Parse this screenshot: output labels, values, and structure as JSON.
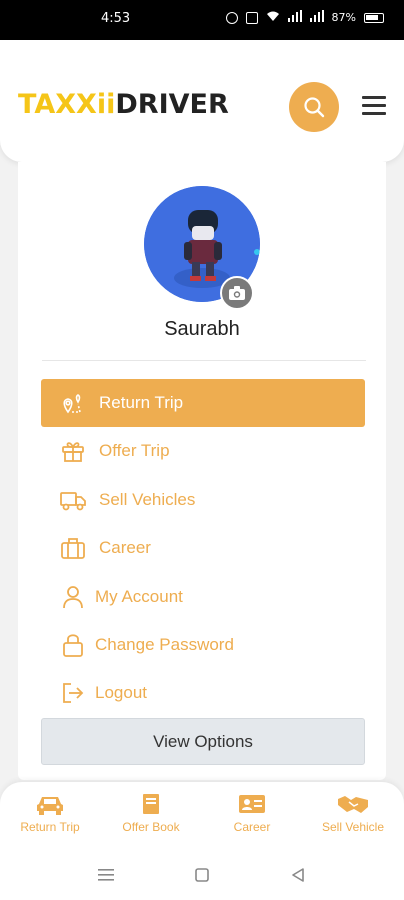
{
  "status_bar": {
    "time": "4:53",
    "battery": "87%"
  },
  "header": {
    "brand_part1": "TAXXii",
    "brand_part2": "DRIVER"
  },
  "profile": {
    "name": "Saurabh"
  },
  "menu": [
    {
      "label": "Return Trip",
      "icon": "map-pin-route-icon",
      "active": true
    },
    {
      "label": "Offer Trip",
      "icon": "gift-icon",
      "active": false
    },
    {
      "label": "Sell Vehicles",
      "icon": "truck-icon",
      "active": false
    },
    {
      "label": "Career",
      "icon": "briefcase-icon",
      "active": false
    },
    {
      "label": "My Account",
      "icon": "user-icon",
      "active": false
    },
    {
      "label": "Change Password",
      "icon": "lock-icon",
      "active": false
    },
    {
      "label": "Logout",
      "icon": "logout-icon",
      "active": false
    }
  ],
  "view_options_label": "View Options",
  "bottom_nav": [
    {
      "label": "Return Trip",
      "icon": "car-icon"
    },
    {
      "label": "Offer Book",
      "icon": "book-icon"
    },
    {
      "label": "Career",
      "icon": "id-card-icon"
    },
    {
      "label": "Sell Vehicle",
      "icon": "handshake-icon"
    }
  ],
  "colors": {
    "accent": "#eead50",
    "brand_yellow": "#f5c518",
    "dark": "#222222"
  }
}
